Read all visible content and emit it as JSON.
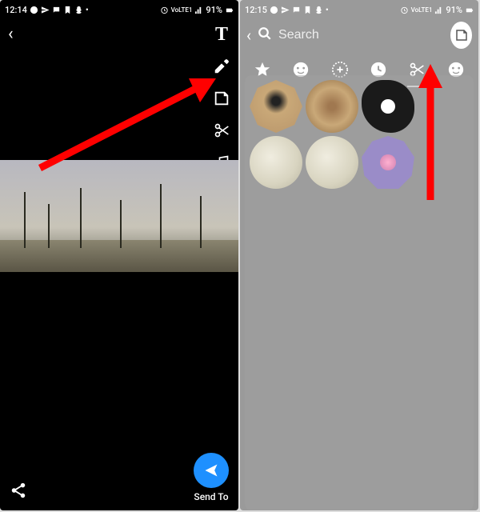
{
  "left": {
    "status": {
      "time": "12:14",
      "battery": "91%",
      "net": "VoLTE1"
    },
    "send_label": "Send To"
  },
  "right": {
    "status": {
      "time": "12:15",
      "battery": "91%",
      "net": "VoLTE1"
    },
    "search": {
      "placeholder": "Search",
      "value": ""
    }
  }
}
